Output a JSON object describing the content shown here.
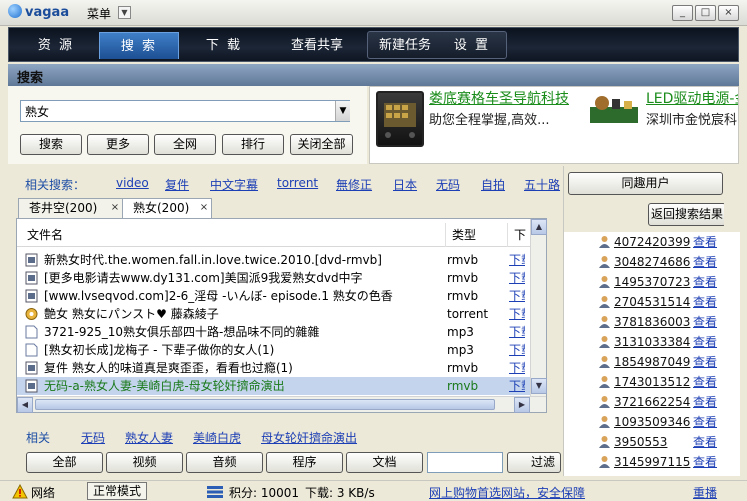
{
  "app": {
    "logo_text": "vagaa",
    "menu_label": "菜单"
  },
  "window_controls": {
    "minimize": "_",
    "maximize": "□",
    "close": "×"
  },
  "nav": {
    "tabs": [
      {
        "label": "资 源"
      },
      {
        "label": "搜 索",
        "active": true
      },
      {
        "label": "下 载"
      },
      {
        "label": "查看共享"
      }
    ],
    "group2": [
      {
        "label": "新建任务"
      },
      {
        "label": "设 置"
      }
    ]
  },
  "section_title": "搜索",
  "search": {
    "value": "熟女",
    "buttons": [
      "搜索",
      "更多",
      "全网",
      "排行",
      "关闭全部"
    ]
  },
  "ads": [
    {
      "title": "娄底赛格车圣导航科技",
      "desc": "助您全程掌握,高效..."
    },
    {
      "title": "LED驱动电源-金",
      "desc": "深圳市金悦宸科"
    }
  ],
  "related_top": {
    "label": "相关搜索：",
    "links": [
      "video",
      "复件",
      "中文字幕",
      "torrent",
      "無修正",
      "日本",
      "无码",
      "自拍",
      "五十路"
    ]
  },
  "result_tabs": [
    {
      "label": "苍井空(200)"
    },
    {
      "label": "熟女(200)",
      "active": true
    }
  ],
  "results": {
    "columns": {
      "name": "文件名",
      "type": "类型",
      "dl": "下载"
    },
    "rows": [
      {
        "name": "新熟女时代.the.women.fall.in.love.twice.2010.[dvd-rmvb]",
        "type": "rmvb",
        "icon": "video-file-icon"
      },
      {
        "name": "[更多电影请去www.dy131.com]美国派9我爱熟女dvd中字",
        "type": "rmvb",
        "icon": "video-file-icon"
      },
      {
        "name": "[www.lvseqvod.com]2-6_淫母 -いんぼ- episode.1 熟女の色香",
        "type": "rmvb",
        "icon": "video-file-icon"
      },
      {
        "name": "艶女 熟女にパンスト♥ 藤森綾子",
        "type": "torrent",
        "icon": "torrent-file-icon"
      },
      {
        "name": "3721-925_10熟女俱乐部四十路-想品味不同的雜雜",
        "type": "mp3",
        "icon": "document-file-icon"
      },
      {
        "name": "[熟女初长成]龙梅子 - 下辈子做你的女人(1)",
        "type": "mp3",
        "icon": "document-file-icon"
      },
      {
        "name": "复件 熟女人的味道真是爽歪歪，看看也过瘾(1)",
        "type": "rmvb",
        "icon": "video-file-icon"
      },
      {
        "name": "无码-a-熟女人妻-美崎白虎-母女轮奸擠命演出",
        "type": "rmvb",
        "icon": "video-file-icon",
        "selected": true
      }
    ],
    "dl_label": "下载"
  },
  "related_bottom": {
    "label": "相关",
    "links": [
      "无码",
      "熟女人妻",
      "美崎白虎",
      "母女轮奸擠命演出"
    ]
  },
  "filters": {
    "buttons": [
      "全部",
      "视频",
      "音频",
      "程序",
      "文档"
    ],
    "input_value": "",
    "filter_label": "过滤"
  },
  "right_panel": {
    "peers_button": "同趣用户",
    "back_button": "返回搜索结果",
    "users": [
      {
        "id": "4072420399",
        "view": "查看"
      },
      {
        "id": "3048274686",
        "view": "查看"
      },
      {
        "id": "1495370723",
        "view": "查看"
      },
      {
        "id": "2704531514",
        "view": "查看"
      },
      {
        "id": "3781836003",
        "view": "查看"
      },
      {
        "id": "3131033384",
        "view": "查看"
      },
      {
        "id": "1854987049",
        "view": "查看"
      },
      {
        "id": "1743013512",
        "view": "查看"
      },
      {
        "id": "3721662254",
        "view": "查看"
      },
      {
        "id": "1093509346",
        "view": "查看"
      },
      {
        "id": "3950553",
        "view": "查看"
      },
      {
        "id": "3145997115",
        "view": "查看"
      }
    ]
  },
  "statusbar": {
    "network_label": "网络",
    "mode_label": "正常模式",
    "points": "积分: 10001",
    "download_speed": "下载: 3 KB/s",
    "promo_link": "网上购物首选网站，安全保障",
    "replay": "重播"
  },
  "colors": {
    "nav_bg": "#111a29",
    "nav_active": "#2a66b1",
    "link": "#1d3fb5",
    "ad_title": "#1a8c1a",
    "selected_row": "#c3d4ec"
  }
}
